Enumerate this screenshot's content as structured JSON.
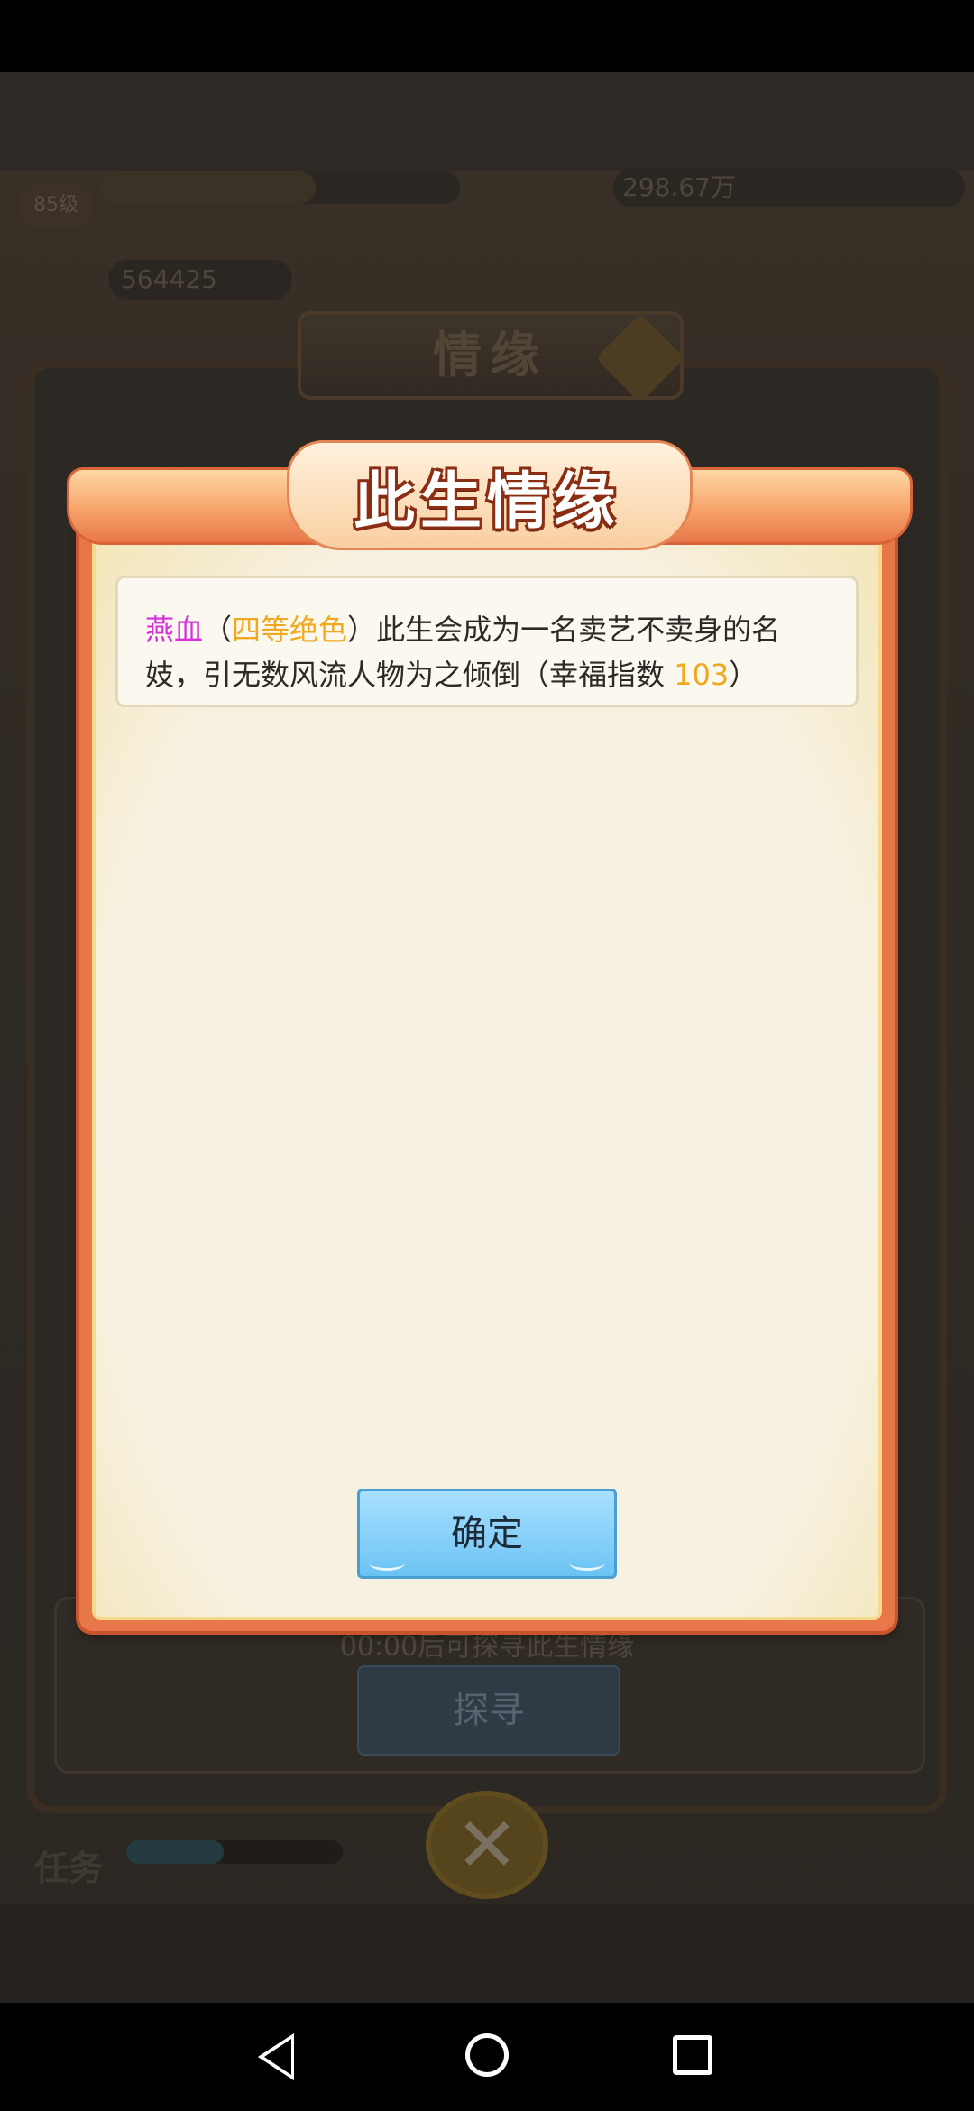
{
  "background": {
    "header_title": "",
    "level_badge": "85级",
    "silver": "298.67万",
    "gold": "564425",
    "panel_title": "情缘",
    "timer_text": "00:00后可探寻此生情缘",
    "seek_button": "探寻",
    "task_label": "任务",
    "task_progress": 0.45
  },
  "dialog": {
    "title": "此生情缘",
    "message": {
      "name": "燕血",
      "open_paren": "（",
      "rank": "四等绝色",
      "close_paren": "）",
      "text": "此生会成为一名卖艺不卖身的名妓，引无数风流人物为之倾倒（幸福指数 ",
      "score": "103",
      "end": "）"
    },
    "confirm_button": "确定"
  },
  "close_icon": "close-icon",
  "navigation": {
    "back": "back-icon",
    "home": "home-icon",
    "recents": "recents-icon"
  }
}
